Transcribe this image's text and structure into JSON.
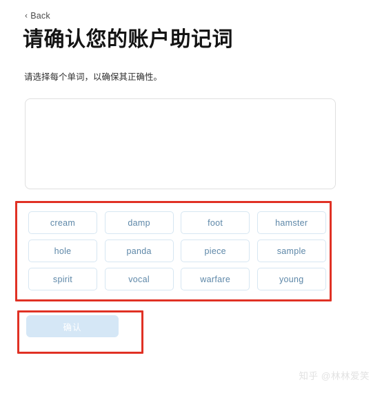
{
  "nav": {
    "back_label": "Back",
    "back_chevron": "‹",
    "back_icon_name": "chevron-left-icon"
  },
  "header": {
    "title": "请确认您的账户助记词",
    "subtitle": "请选择每个单词，以确保其正确性。"
  },
  "dropzone": {
    "placeholder": "",
    "value": ""
  },
  "word_bank": {
    "words": [
      "cream",
      "damp",
      "foot",
      "hamster",
      "hole",
      "panda",
      "piece",
      "sample",
      "spirit",
      "vocal",
      "warfare",
      "young"
    ]
  },
  "actions": {
    "confirm_label": "确认",
    "confirm_disabled": true
  },
  "annotations": [
    {
      "name": "word-bank-highlight",
      "color": "#e03124"
    },
    {
      "name": "confirm-button-highlight",
      "color": "#e03124"
    }
  ],
  "watermark": {
    "text": "知乎 @林林爱笑"
  },
  "colors": {
    "accent": "#5d87a8",
    "chip_border": "#d6e6f2",
    "button_disabled_bg": "#d5e7f6",
    "annotation_red": "#e03124",
    "dropzone_border": "#dfdfdf",
    "title": "#141414"
  }
}
